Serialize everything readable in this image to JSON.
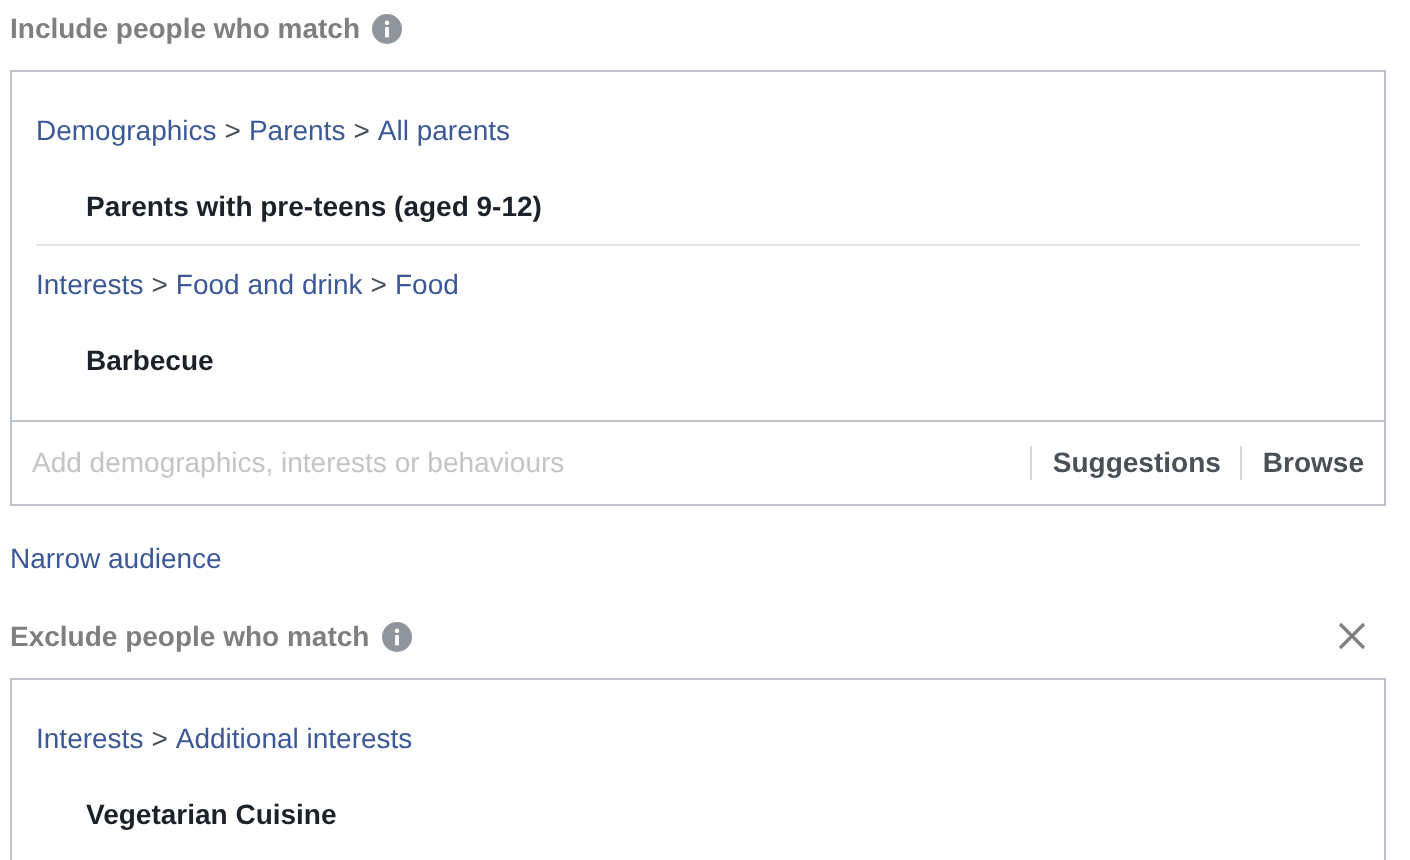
{
  "include": {
    "title": "Include people who match",
    "groups": [
      {
        "path": [
          "Demographics",
          "Parents",
          "All parents"
        ],
        "separator": ">",
        "items": [
          "Parents with pre-teens (aged 9-12)"
        ]
      },
      {
        "path": [
          "Interests",
          "Food and drink",
          "Food"
        ],
        "separator": ">",
        "items": [
          "Barbecue"
        ]
      }
    ],
    "search": {
      "placeholder": "Add demographics, interests or behaviours"
    },
    "actions": [
      "Suggestions",
      "Browse"
    ]
  },
  "narrow_link": "Narrow audience",
  "exclude": {
    "title": "Exclude people who match",
    "groups": [
      {
        "path": [
          "Interests",
          "Additional interests"
        ],
        "separator": ">",
        "items": [
          "Vegetarian Cuisine"
        ]
      }
    ]
  }
}
